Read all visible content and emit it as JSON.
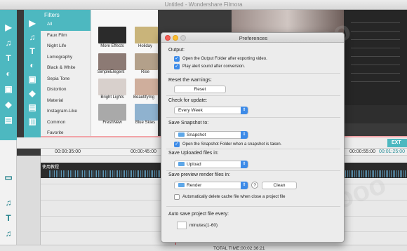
{
  "background_app": {
    "window_title": "Untitled - Wondershare Filmora",
    "filters_header": "Filters",
    "filter_categories": [
      "All",
      "Faux Film",
      "Night Life",
      "Lomography",
      "Black & White",
      "Sepia Tone",
      "Distortion",
      "Material",
      "Instagram-Like",
      "Common",
      "Favorite"
    ],
    "active_category": "All",
    "thumbnails": [
      {
        "label": "More Effects",
        "color": "#2b2b2b"
      },
      {
        "label": "Holiday",
        "color": "#c9b47a"
      },
      {
        "label": "SimpleElegent",
        "color": "#8c7a74"
      },
      {
        "label": "Rise",
        "color": "#b3a08a"
      },
      {
        "label": "Bright Lights",
        "color": "#d8d0cc"
      },
      {
        "label": "BeautifyIng",
        "color": "#cfae9c"
      },
      {
        "label": "FreshNew",
        "color": "#a9a9a9"
      },
      {
        "label": "Blue Skies",
        "color": "#8fb2cf"
      }
    ],
    "timeline": {
      "time_markers": [
        "00:00:35:00",
        "00:00:45:00",
        "00:00:55:00"
      ],
      "right_timecode": "00:01:25:00",
      "track_label": "使用教程",
      "export_label": "EXT",
      "total_time": "TOTAL TIME:00:02:36:21"
    },
    "watermark": "www.ddooo.com"
  },
  "dialog": {
    "title": "Preferences",
    "output": {
      "label": "Output:",
      "options": [
        {
          "text": "Open the Output Folder after exporting video.",
          "checked": true
        },
        {
          "text": "Play alert sound after conversion.",
          "checked": true
        }
      ]
    },
    "reset": {
      "label": "Reset the warnings:",
      "button": "Reset"
    },
    "update": {
      "label": "Check for update:",
      "value": "Every Week"
    },
    "snapshot": {
      "label": "Save Snapshot to:",
      "value": "Snapshot",
      "option": {
        "text": "Open the Snapshot Folder when a snapshot is taken.",
        "checked": true
      }
    },
    "uploaded": {
      "label": "Save Uploaded files in:",
      "value": "Upload"
    },
    "render": {
      "label": "Save preview render files in:",
      "value": "Render",
      "help": "?",
      "clean_button": "Clean",
      "option": {
        "text": "Automatically delete cache file when close a project file",
        "checked": false
      }
    },
    "autosave": {
      "label": "Auto save project file every:",
      "unit": "minutes(1-60)"
    }
  }
}
